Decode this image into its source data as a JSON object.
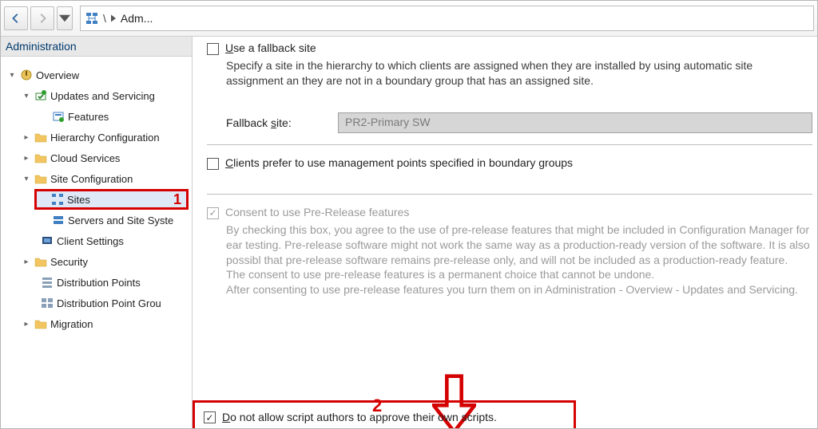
{
  "toolbar": {
    "breadcrumb_text": "Adm..."
  },
  "nav_header": "Administration",
  "tree": {
    "overview": "Overview",
    "updates": "Updates and Servicing",
    "features": "Features",
    "hierarchy": "Hierarchy Configuration",
    "cloud": "Cloud Services",
    "siteconfig": "Site Configuration",
    "sites": "Sites",
    "servers": "Servers and Site Syste",
    "clientsettings": "Client Settings",
    "security": "Security",
    "distpoints": "Distribution Points",
    "distgroups": "Distribution Point Grou",
    "migration": "Migration"
  },
  "annot": {
    "one": "1",
    "two": "2"
  },
  "fallback": {
    "cb_label": "se a fallback site",
    "cb_first": "U",
    "desc": "Specify a site in the hierarchy to which clients are assigned when they are installed by using automatic site assignment an they are not in a boundary group that has an assigned site.",
    "field_label_first": "s",
    "field_label": "ite:",
    "field_prefix": "Fallback ",
    "value": "PR2-Primary SW"
  },
  "mp": {
    "first": "C",
    "label": "lients prefer to use management points specified in boundary groups"
  },
  "prerelease": {
    "label": "Consent to use Pre-Release features",
    "p1": "By checking this box, you agree to the use of pre-release features that might be included in Configuration Manager for ear testing. Pre-release software might not work the same way as a production-ready version of the software. It is also possibl that pre-release software remains pre-release only, and will not be included as a production-ready feature.",
    "p2": "The consent to use pre-release features is a permanent choice that cannot be undone.",
    "p3": "After consenting to use pre-release features you turn them on in Administration - Overview - Updates and Servicing."
  },
  "scripts": {
    "first": "D",
    "label": "o not allow script authors to approve their own scripts."
  }
}
